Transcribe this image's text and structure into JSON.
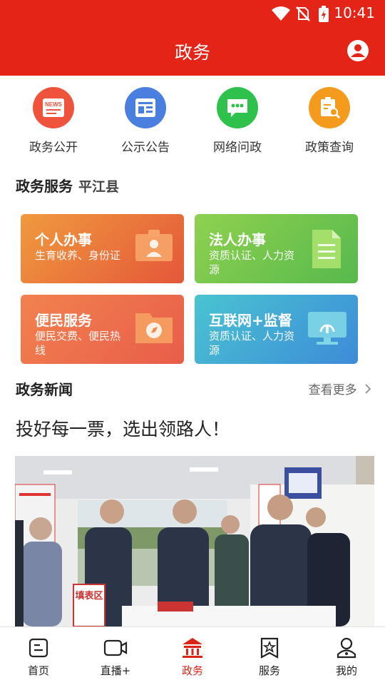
{
  "status_bar": {
    "time": "10:41"
  },
  "header": {
    "title": "政务"
  },
  "quick_links": [
    {
      "label": "政务公开",
      "icon": "news-icon",
      "color": "#f0533b",
      "badge": "NEWS"
    },
    {
      "label": "公示公告",
      "icon": "notice-board-icon",
      "color": "#4a7fe0"
    },
    {
      "label": "网络问政",
      "icon": "chat-bubble-icon",
      "color": "#2ec24d"
    },
    {
      "label": "政策查询",
      "icon": "document-search-icon",
      "color": "#f49a1c"
    }
  ],
  "services": {
    "title": "政务服务",
    "region": "平江县",
    "cards": [
      {
        "title": "个人办事",
        "subtitle": "生育收养、身份证",
        "icon": "id-card-icon"
      },
      {
        "title": "法人办事",
        "subtitle": "资质认证、人力资源",
        "icon": "document-icon"
      },
      {
        "title": "便民服务",
        "subtitle": "便民交费、便民热线",
        "icon": "compass-folder-icon"
      },
      {
        "title": "互联网+监督",
        "subtitle": "资质认证、人力资源",
        "icon": "monitor-icon"
      }
    ]
  },
  "news": {
    "title": "政务新闻",
    "more_label": "查看更多",
    "headline": "投好每一票，选出领路人！",
    "photo_sign": "填表区"
  },
  "tabbar": [
    {
      "label": "首页",
      "icon": "home-doc-icon",
      "active": false
    },
    {
      "label": "直播+",
      "icon": "video-camera-icon",
      "active": false
    },
    {
      "label": "政务",
      "icon": "government-building-icon",
      "active": true
    },
    {
      "label": "服务",
      "icon": "star-bookmark-icon",
      "active": false
    },
    {
      "label": "我的",
      "icon": "profile-icon",
      "active": false
    }
  ],
  "colors": {
    "brand_red": "#e32417",
    "active_tab": "#d92417"
  }
}
